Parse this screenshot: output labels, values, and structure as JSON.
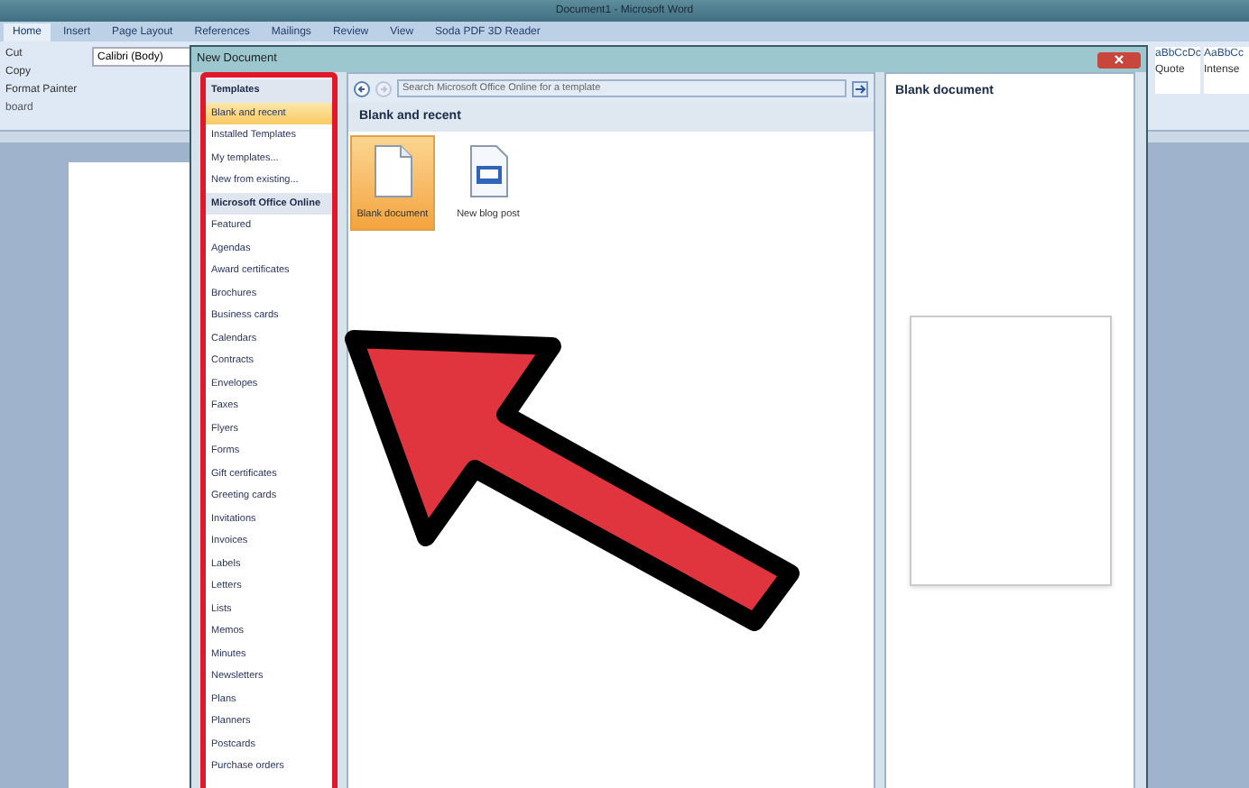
{
  "word": {
    "title": "Document1 - Microsoft Word",
    "ribbon_tabs": [
      {
        "label": "Home",
        "selected": true
      },
      {
        "label": "Insert",
        "selected": false
      },
      {
        "label": "Page Layout",
        "selected": false
      },
      {
        "label": "References",
        "selected": false
      },
      {
        "label": "Mailings",
        "selected": false
      },
      {
        "label": "Review",
        "selected": false
      },
      {
        "label": "View",
        "selected": false
      },
      {
        "label": "Soda PDF 3D Reader",
        "selected": false
      }
    ],
    "clipboard": {
      "items": [
        "Cut",
        "Copy",
        "Format Painter"
      ],
      "group_label": "board"
    },
    "font_box": "Calibri (Body)",
    "styles": [
      {
        "preview": "aBbCcDc",
        "name": "Quote"
      },
      {
        "preview": "AaBbCc",
        "name": "Intense"
      }
    ]
  },
  "dialog": {
    "title": "New Document",
    "sidebar": [
      {
        "label": "Templates",
        "kind": "header",
        "selected": false
      },
      {
        "label": "Blank and recent",
        "kind": "item",
        "selected": true
      },
      {
        "label": "Installed Templates",
        "kind": "item",
        "selected": false
      },
      {
        "label": "My templates...",
        "kind": "item",
        "selected": false
      },
      {
        "label": "New from existing...",
        "kind": "item",
        "selected": false
      },
      {
        "label": "Microsoft Office Online",
        "kind": "header",
        "selected": false
      },
      {
        "label": "Featured",
        "kind": "item",
        "selected": false
      },
      {
        "label": "Agendas",
        "kind": "item",
        "selected": false
      },
      {
        "label": "Award certificates",
        "kind": "item",
        "selected": false
      },
      {
        "label": "Brochures",
        "kind": "item",
        "selected": false
      },
      {
        "label": "Business cards",
        "kind": "item",
        "selected": false
      },
      {
        "label": "Calendars",
        "kind": "item",
        "selected": false
      },
      {
        "label": "Contracts",
        "kind": "item",
        "selected": false
      },
      {
        "label": "Envelopes",
        "kind": "item",
        "selected": false
      },
      {
        "label": "Faxes",
        "kind": "item",
        "selected": false
      },
      {
        "label": "Flyers",
        "kind": "item",
        "selected": false
      },
      {
        "label": "Forms",
        "kind": "item",
        "selected": false
      },
      {
        "label": "Gift certificates",
        "kind": "item",
        "selected": false
      },
      {
        "label": "Greeting cards",
        "kind": "item",
        "selected": false
      },
      {
        "label": "Invitations",
        "kind": "item",
        "selected": false
      },
      {
        "label": "Invoices",
        "kind": "item",
        "selected": false
      },
      {
        "label": "Labels",
        "kind": "item",
        "selected": false
      },
      {
        "label": "Letters",
        "kind": "item",
        "selected": false
      },
      {
        "label": "Lists",
        "kind": "item",
        "selected": false
      },
      {
        "label": "Memos",
        "kind": "item",
        "selected": false
      },
      {
        "label": "Minutes",
        "kind": "item",
        "selected": false
      },
      {
        "label": "Newsletters",
        "kind": "item",
        "selected": false
      },
      {
        "label": "Plans",
        "kind": "item",
        "selected": false
      },
      {
        "label": "Planners",
        "kind": "item",
        "selected": false
      },
      {
        "label": "Postcards",
        "kind": "item",
        "selected": false
      },
      {
        "label": "Purchase orders",
        "kind": "item",
        "selected": false
      }
    ],
    "search": {
      "placeholder": "Search Microsoft Office Online for a template"
    },
    "section_title": "Blank and recent",
    "templates": [
      {
        "label": "Blank document",
        "kind": "blank",
        "selected": true
      },
      {
        "label": "New blog post",
        "kind": "blog",
        "selected": false
      }
    ],
    "preview_title": "Blank document"
  }
}
